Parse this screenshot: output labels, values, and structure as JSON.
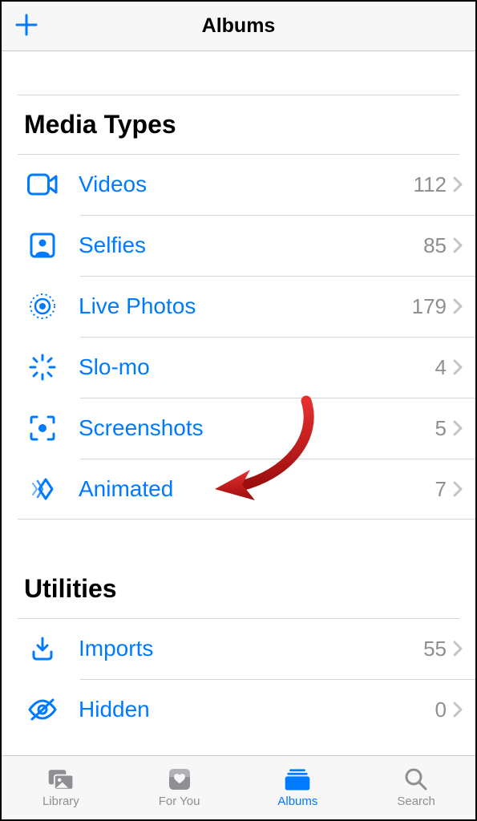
{
  "navbar": {
    "title": "Albums"
  },
  "sections": {
    "media_types": {
      "title": "Media Types",
      "items": [
        {
          "label": "Videos",
          "count": "112"
        },
        {
          "label": "Selfies",
          "count": "85"
        },
        {
          "label": "Live Photos",
          "count": "179"
        },
        {
          "label": "Slo-mo",
          "count": "4"
        },
        {
          "label": "Screenshots",
          "count": "5"
        },
        {
          "label": "Animated",
          "count": "7"
        }
      ]
    },
    "utilities": {
      "title": "Utilities",
      "items": [
        {
          "label": "Imports",
          "count": "55"
        },
        {
          "label": "Hidden",
          "count": "0"
        }
      ]
    }
  },
  "tabs": [
    {
      "label": "Library"
    },
    {
      "label": "For You"
    },
    {
      "label": "Albums"
    },
    {
      "label": "Search"
    }
  ]
}
